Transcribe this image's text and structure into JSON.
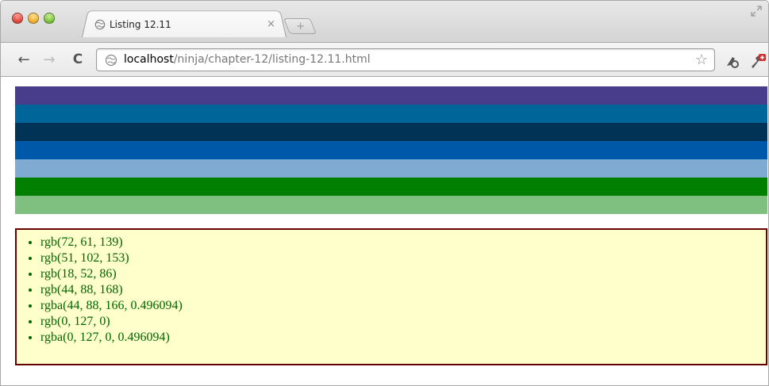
{
  "browser": {
    "tab": {
      "title": "Listing 12.11",
      "close_glyph": "×",
      "favicon": "globe-icon"
    },
    "new_tab_glyph": "+",
    "toolbar": {
      "back_glyph": "←",
      "forward_glyph": "→",
      "reload_glyph": "C",
      "url_host": "localhost",
      "url_path": "/ninja/chapter-12/listing-12.11.html",
      "star_glyph": "☆"
    }
  },
  "page": {
    "bars": [
      {
        "color": "rgb(72, 61, 139)"
      },
      {
        "color": "rgb(0, 102, 153)"
      },
      {
        "color": "rgb(0, 51, 85)"
      },
      {
        "color": "rgb(0, 88, 168)"
      },
      {
        "color": "rgba(0, 88, 166, 0.5)"
      },
      {
        "color": "rgb(0, 127, 0)"
      },
      {
        "color": "rgba(0, 127, 0, 0.5)"
      }
    ],
    "color_list": {
      "items": [
        "rgb(72, 61, 139)",
        "rgb(51, 102, 153)",
        "rgb(18, 52, 86)",
        "rgb(44, 88, 168)",
        "rgba(44, 88, 166, 0.496094)",
        "rgb(0, 127, 0)",
        "rgba(0, 127, 0, 0.496094)"
      ],
      "text_color": "#006600",
      "background": "#ffffcc",
      "border_color": "#660000"
    }
  }
}
